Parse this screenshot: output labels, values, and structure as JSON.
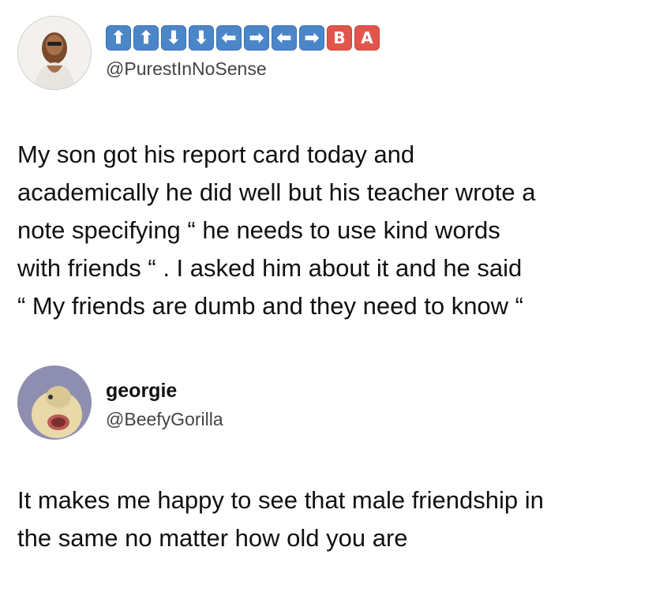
{
  "post1": {
    "emoji_name": [
      "⬆",
      "⬆",
      "⬇",
      "⬇",
      "⬅",
      "➡",
      "⬅",
      "➡",
      "B",
      "A"
    ],
    "handle": "@PurestInNoSense",
    "lines": [
      "My son got his report card today and",
      "academically he did well but his teacher wrote a",
      "note specifying “ he needs to use kind words",
      "with friends “ . I asked him about it and he said",
      "“ My friends are dumb and they need to know “"
    ]
  },
  "post2": {
    "display_name": "georgie",
    "handle": "@BeefyGorilla",
    "lines": [
      "It makes me happy to see that male friendship in",
      "the same no matter how old you are"
    ]
  },
  "colors": {
    "arrow_key": "#4b86c9",
    "letter_key": "#e2554b"
  }
}
